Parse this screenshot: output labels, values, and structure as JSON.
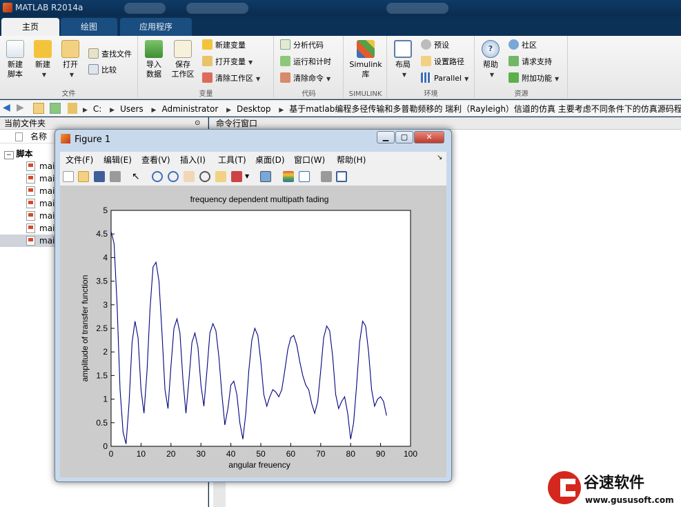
{
  "window": {
    "title": "MATLAB R2014a"
  },
  "tabs": [
    {
      "label": "主页",
      "active": true
    },
    {
      "label": "绘图",
      "active": false
    },
    {
      "label": "应用程序",
      "active": false
    }
  ],
  "ribbon": {
    "file": {
      "new_script": "新建\n脚本",
      "new": "新建",
      "open": "打开",
      "find_files": "查找文件",
      "compare": "比较",
      "label": "文件"
    },
    "variable": {
      "import_data": "导入\n数据",
      "save_workspace": "保存\n工作区",
      "new_variable": "新建变量",
      "open_variable": "打开变量",
      "clear_workspace": "清除工作区",
      "label": "变量"
    },
    "code": {
      "analyze_code": "分析代码",
      "run_and_time": "运行和计时",
      "clear_commands": "清除命令",
      "label": "代码"
    },
    "simulink": {
      "simulink_library": "Simulink\n库",
      "label": "SIMULINK"
    },
    "environment": {
      "layout": "布局",
      "preferences": "预设",
      "set_path": "设置路径",
      "parallel": "Parallel",
      "label": "环境"
    },
    "resources": {
      "help": "帮助",
      "community": "社区",
      "request_support": "请求支持",
      "addons": "附加功能",
      "label": "资源"
    }
  },
  "address": {
    "crumbs": [
      "C:",
      "Users",
      "Administrator",
      "Desktop",
      "基于matlab编程多径传输和多普勒频移的 瑞利（Rayleigh）信道的仿真 主要考虑不同条件下的仿真源码程序"
    ]
  },
  "current_folder": {
    "header": "当前文件夹",
    "column_name": "名称",
    "group": "脚本",
    "files": [
      "mai",
      "mai",
      "mai",
      "mai",
      "mai",
      "mai",
      "mai"
    ],
    "selected_index": 6
  },
  "command_window": {
    "header": "命令行窗口"
  },
  "figure": {
    "title": "Figure 1",
    "menu": [
      "文件(F)",
      "编辑(E)",
      "查看(V)",
      "插入(I)",
      "工具(T)",
      "桌面(D)",
      "窗口(W)",
      "帮助(H)"
    ]
  },
  "chart_data": {
    "type": "line",
    "title": "frequency dependent multipath fading",
    "xlabel": "angular freuency",
    "ylabel": "amplitude of transfer function",
    "xlim": [
      0,
      100
    ],
    "ylim": [
      0,
      5
    ],
    "xticks": [
      0,
      10,
      20,
      30,
      40,
      50,
      60,
      70,
      80,
      90,
      100
    ],
    "yticks": [
      0,
      0.5,
      1,
      1.5,
      2,
      2.5,
      3,
      3.5,
      4,
      4.5,
      5
    ],
    "grid": false,
    "series_color": "#00007f",
    "x": [
      0,
      1,
      2,
      3,
      4,
      5,
      6,
      7,
      8,
      9,
      10,
      11,
      12,
      13,
      14,
      15,
      16,
      17,
      18,
      19,
      20,
      21,
      22,
      23,
      24,
      25,
      26,
      27,
      28,
      29,
      30,
      31,
      32,
      33,
      34,
      35,
      36,
      37,
      38,
      39,
      40,
      41,
      42,
      43,
      44,
      45,
      46,
      47,
      48,
      49,
      50,
      51,
      52,
      53,
      54,
      55,
      56,
      57,
      58,
      59,
      60,
      61,
      62,
      63,
      64,
      65,
      66,
      67,
      68,
      69,
      70,
      71,
      72,
      73,
      74,
      75,
      76,
      77,
      78,
      79,
      80,
      81,
      82,
      83,
      84,
      85,
      86,
      87,
      88,
      89,
      90,
      91,
      92,
      93,
      94,
      95,
      96,
      97,
      98,
      99,
      100
    ],
    "y": [
      4.55,
      4.3,
      3.0,
      1.2,
      0.3,
      0.05,
      0.9,
      2.2,
      2.65,
      2.3,
      1.2,
      0.7,
      1.6,
      2.9,
      3.8,
      3.9,
      3.5,
      2.4,
      1.2,
      0.8,
      1.7,
      2.5,
      2.7,
      2.4,
      1.4,
      0.7,
      1.4,
      2.2,
      2.4,
      2.1,
      1.3,
      0.85,
      1.6,
      2.4,
      2.6,
      2.45,
      1.9,
      1.1,
      0.45,
      0.8,
      1.3,
      1.38,
      1.1,
      0.5,
      0.15,
      0.7,
      1.6,
      2.25,
      2.5,
      2.35,
      1.8,
      1.1,
      0.85,
      1.05,
      1.2,
      1.15,
      1.05,
      1.2,
      1.6,
      2.05,
      2.3,
      2.35,
      2.15,
      1.8,
      1.5,
      1.3,
      1.2,
      0.9,
      0.7,
      0.95,
      1.6,
      2.3,
      2.55,
      2.45,
      1.9,
      1.1,
      0.8,
      0.95,
      1.05,
      0.7,
      0.15,
      0.5,
      1.3,
      2.2,
      2.65,
      2.55,
      2.0,
      1.2,
      0.85,
      1.0,
      1.05,
      0.95,
      0.65
    ]
  },
  "watermark": {
    "brand": "谷速软件",
    "url": "www.gususoft.com"
  }
}
